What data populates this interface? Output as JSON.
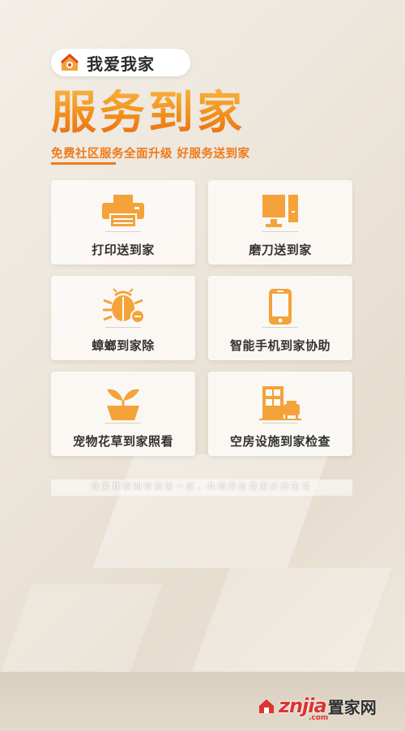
{
  "brand": {
    "name": "我爱我家"
  },
  "headline": "服务到家",
  "subline": "免费社区服务全面升级  好服务送到家",
  "services": [
    {
      "label": "打印送到家",
      "icon": "printer-icon"
    },
    {
      "label": "磨刀送到家",
      "icon": "knife-icon"
    },
    {
      "label": "蟑螂到家除",
      "icon": "bug-icon"
    },
    {
      "label": "智能手机到家协助",
      "icon": "smartphone-icon"
    },
    {
      "label": "宠物花草到家照看",
      "icon": "plant-icon"
    },
    {
      "label": "空房设施到家检查",
      "icon": "house-furniture-icon"
    }
  ],
  "footer": "我爱我家期待和您一起，共同奔赴更美好的生活",
  "watermark": {
    "brand": "znjia",
    "cn": "置家网",
    "domain": ".com"
  },
  "colors": {
    "accent": "#ef7a1a",
    "icon": "#f4a23a"
  }
}
